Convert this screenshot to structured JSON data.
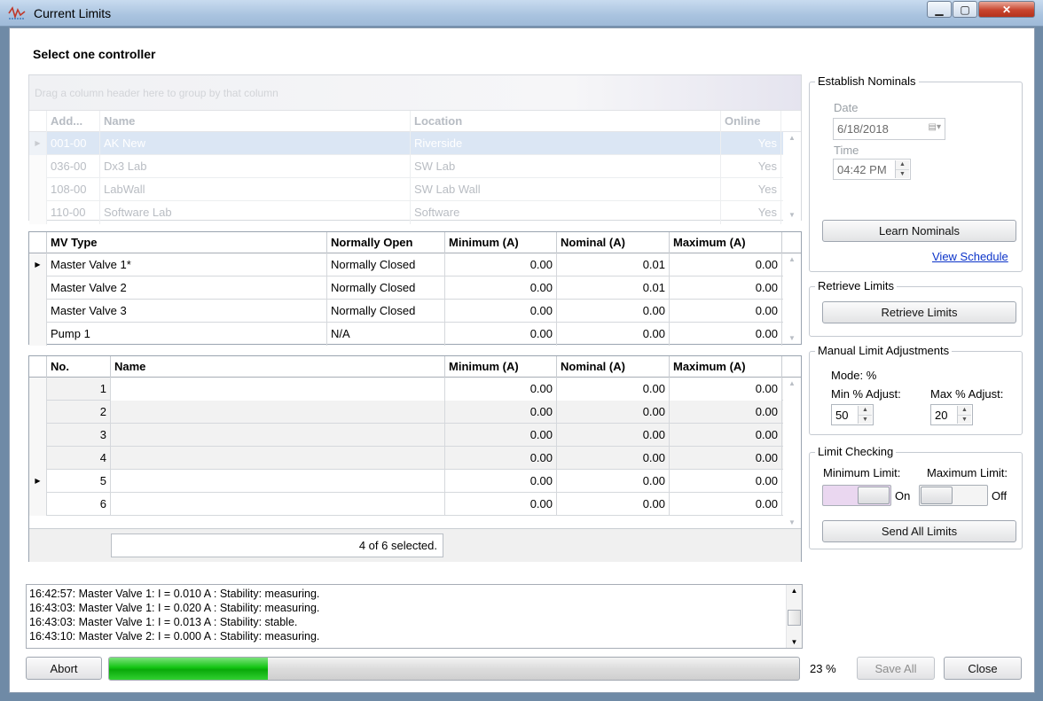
{
  "window": {
    "title": "Current Limits"
  },
  "controller_section": {
    "title": "Select one controller",
    "group_hint": "Drag a column header here to group by that column",
    "columns": [
      "Add...",
      "Name",
      "Location",
      "Online"
    ],
    "rows": [
      {
        "address": "001-00",
        "name": "AK New",
        "location": "Riverside",
        "online": "Yes"
      },
      {
        "address": "036-00",
        "name": "Dx3 Lab",
        "location": "SW Lab",
        "online": "Yes"
      },
      {
        "address": "108-00",
        "name": "LabWall",
        "location": "SW Lab Wall",
        "online": "Yes"
      },
      {
        "address": "110-00",
        "name": "Software Lab",
        "location": "Software",
        "online": "Yes"
      }
    ]
  },
  "mv_grid": {
    "columns": [
      "MV Type",
      "Normally Open",
      "Minimum (A)",
      "Nominal (A)",
      "Maximum (A)"
    ],
    "rows": [
      {
        "type": "Master Valve 1*",
        "normally_open": "Normally Closed",
        "min": "0.00",
        "nominal": "0.01",
        "max": "0.00"
      },
      {
        "type": "Master Valve 2",
        "normally_open": "Normally Closed",
        "min": "0.00",
        "nominal": "0.01",
        "max": "0.00"
      },
      {
        "type": "Master Valve 3",
        "normally_open": "Normally Closed",
        "min": "0.00",
        "nominal": "0.00",
        "max": "0.00"
      },
      {
        "type": "Pump 1",
        "normally_open": "N/A",
        "min": "0.00",
        "nominal": "0.00",
        "max": "0.00"
      }
    ]
  },
  "station_grid": {
    "columns": [
      "No.",
      "Name",
      "Minimum (A)",
      "Nominal (A)",
      "Maximum (A)"
    ],
    "rows": [
      {
        "no": "1",
        "name": "",
        "min": "0.00",
        "nominal": "0.00",
        "max": "0.00"
      },
      {
        "no": "2",
        "name": "",
        "min": "0.00",
        "nominal": "0.00",
        "max": "0.00"
      },
      {
        "no": "3",
        "name": "",
        "min": "0.00",
        "nominal": "0.00",
        "max": "0.00"
      },
      {
        "no": "4",
        "name": "",
        "min": "0.00",
        "nominal": "0.00",
        "max": "0.00"
      },
      {
        "no": "5",
        "name": "",
        "min": "0.00",
        "nominal": "0.00",
        "max": "0.00"
      },
      {
        "no": "6",
        "name": "",
        "min": "0.00",
        "nominal": "0.00",
        "max": "0.00"
      }
    ],
    "footer": "4 of 6 selected."
  },
  "establish_nominals": {
    "title": "Establish Nominals",
    "date_label": "Date",
    "date_value": "6/18/2018",
    "time_label": "Time",
    "time_value": "04:42 PM",
    "learn_button": "Learn Nominals",
    "schedule_link": "View Schedule"
  },
  "retrieve_limits": {
    "title": "Retrieve Limits",
    "button": "Retrieve Limits"
  },
  "manual_adjust": {
    "title": "Manual Limit Adjustments",
    "mode": "Mode: %",
    "min_label": "Min % Adjust:",
    "min_value": "50",
    "max_label": "Max % Adjust:",
    "max_value": "20"
  },
  "limit_checking": {
    "title": "Limit Checking",
    "min_label": "Minimum Limit:",
    "min_state": "On",
    "max_label": "Maximum Limit:",
    "max_state": "Off",
    "send_button": "Send All Limits"
  },
  "log": [
    "16:42:57: Master Valve 1: I = 0.010 A : Stability: measuring.",
    "16:43:03: Master Valve 1: I = 0.020 A : Stability: measuring.",
    "16:43:03: Master Valve 1: I = 0.013 A : Stability: stable.",
    "16:43:10: Master Valve 2: I = 0.000 A : Stability: measuring."
  ],
  "bottom_bar": {
    "abort": "Abort",
    "progress_percent": 23,
    "progress_text": "23 %",
    "save_all": "Save All",
    "close": "Close"
  },
  "colors": {
    "progress_green": "#13c413",
    "selection": "#d7e5f6",
    "toggle_on": "#ead7f0",
    "link": "#0b33c9"
  },
  "icons": [
    "app-icon",
    "minimize-icon",
    "maximize-icon",
    "close-icon",
    "row-pointer-icon",
    "calendar-icon",
    "scroll-up-icon",
    "scroll-down-icon",
    "spin-up-icon",
    "spin-down-icon"
  ]
}
